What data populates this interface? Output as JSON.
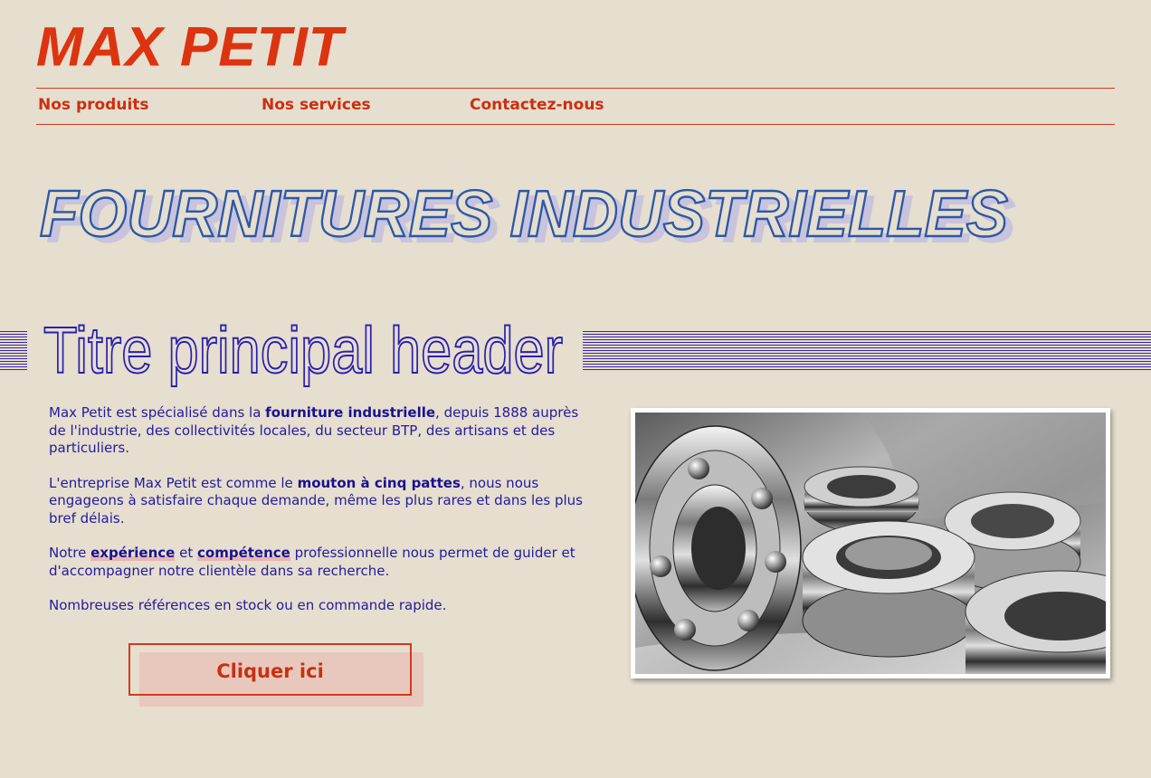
{
  "brand": {
    "logo": "MAX PETIT",
    "color": "#dc3410"
  },
  "nav": {
    "items": [
      {
        "label": "Nos produits"
      },
      {
        "label": "Nos services"
      },
      {
        "label": "Contactez-nous"
      }
    ]
  },
  "hero": {
    "title": "FOURNITURES INDUSTRIELLES",
    "stroke_color": "#2b58a8",
    "shadow_color": "#c9c3dc"
  },
  "main": {
    "title": "Titre principal header",
    "paragraphs": {
      "p1": {
        "a": "Max Petit est spécialisé dans la ",
        "b": "fourniture industrielle",
        "c": ", depuis 1888 auprès de l'industrie, des collectivités locales, du secteur BTP, des artisans et des particuliers."
      },
      "p2": {
        "a": "L'entreprise Max Petit est comme le ",
        "b": "mouton à cinq pattes",
        "c": ", nous nous engageons à satisfaire chaque demande, même les plus rares et dans les plus bref délais."
      },
      "p3": {
        "a": "Notre ",
        "b": "expérience",
        "c": " et ",
        "d": "compétence",
        "e": " professionnelle nous permet de guider et d'accompagner notre clientèle dans sa recherche."
      },
      "p4": {
        "a": "Nombreuses références en stock ou en commande rapide."
      }
    },
    "cta_label": "Cliquer ici"
  },
  "image": {
    "subject": "ball-bearings-photo"
  },
  "colors": {
    "background": "#e6dece",
    "accent": "#d23a1e",
    "text": "#231a9e"
  }
}
